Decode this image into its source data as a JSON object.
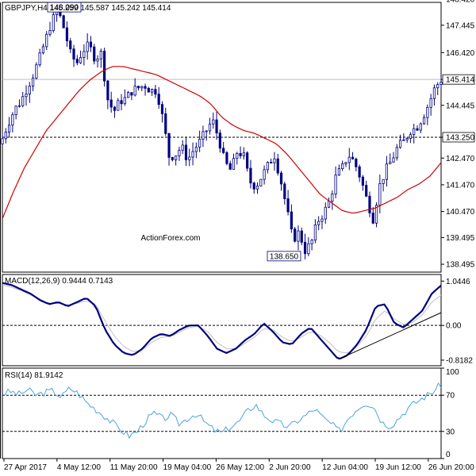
{
  "chart_data": [
    {
      "type": "candlestick",
      "title": "GBPJPY,H4 145.259 145.587 145.242 145.414",
      "watermark": "ActionForex.com",
      "ylim": [
        138.2,
        148.3
      ],
      "yticks": [
        "148.420",
        "147.445",
        "146.420",
        "145.414",
        "144.445",
        "143.250",
        "142.470",
        "141.470",
        "140.470",
        "139.495",
        "138.495"
      ],
      "current_price": "145.414",
      "horizontal_lines": [
        {
          "label": "143.250",
          "value": 143.25,
          "style": "dashed"
        },
        {
          "label": "145.414",
          "value": 145.414,
          "style": "solid"
        }
      ],
      "annotations": [
        {
          "label": "148.090",
          "value": 148.09,
          "at": "high"
        },
        {
          "label": "138.650",
          "value": 138.65,
          "at": "low"
        }
      ],
      "series": [
        {
          "type": "candles",
          "count": 130,
          "color": "#000080",
          "close_path": [
            143.2,
            143.8,
            144.3,
            144.6,
            145.1,
            145.6,
            146.2,
            146.9,
            147.6,
            148.0,
            147.3,
            146.4,
            146.0,
            146.5,
            146.7,
            146.2,
            146.4,
            144.7,
            144.2,
            144.6,
            144.7,
            145.0,
            145.1,
            145.2,
            145.0,
            145.0,
            143.9,
            142.5,
            142.6,
            142.9,
            142.4,
            142.8,
            143.1,
            143.5,
            143.9,
            143.2,
            142.3,
            142.0,
            142.7,
            142.6,
            141.6,
            141.4,
            141.8,
            142.2,
            142.6,
            141.7,
            140.6,
            139.4,
            139.7,
            139.0,
            139.3,
            140.1,
            140.4,
            140.9,
            141.8,
            142.1,
            142.6,
            142.3,
            141.7,
            140.9,
            140.2,
            141.4,
            142.0,
            142.4,
            142.9,
            143.1,
            143.5,
            143.6,
            144.0,
            144.5,
            145.1,
            145.4
          ]
        },
        {
          "type": "line",
          "name": "MA",
          "color": "#d00000",
          "values": [
            140.2,
            141.2,
            142.1,
            142.8,
            143.5,
            144.0,
            144.5,
            145.0,
            145.4,
            145.7,
            145.9,
            145.9,
            145.8,
            145.7,
            145.6,
            145.4,
            145.2,
            145.0,
            144.8,
            144.5,
            144.0,
            143.7,
            143.5,
            143.4,
            143.2,
            143.0,
            142.6,
            142.1,
            141.6,
            141.1,
            140.8,
            140.5,
            140.4,
            140.5,
            140.6,
            140.8,
            141.0,
            141.3,
            141.5,
            141.8,
            142.3
          ]
        }
      ]
    },
    {
      "type": "line",
      "title": "MACD(12,26,9) 0.9444 0.7143",
      "ylim": [
        -0.95,
        1.2
      ],
      "yticks": [
        "1.0446",
        "0.00",
        "-0.8182"
      ],
      "series": [
        {
          "name": "",
          "color": "#000080",
          "values": [
            1.0,
            0.95,
            0.85,
            0.75,
            0.6,
            0.5,
            0.55,
            0.45,
            0.55,
            0.65,
            0.45,
            -0.1,
            -0.45,
            -0.65,
            -0.7,
            -0.55,
            -0.3,
            -0.2,
            -0.25,
            -0.1,
            0.0,
            0.0,
            -0.25,
            -0.55,
            -0.65,
            -0.55,
            -0.35,
            -0.2,
            0.05,
            -0.15,
            -0.4,
            -0.45,
            -0.2,
            -0.05,
            -0.3,
            -0.55,
            -0.8,
            -0.7,
            -0.45,
            -0.1,
            0.45,
            0.5,
            0.05,
            -0.05,
            0.15,
            0.35,
            0.75,
            0.94
          ]
        },
        {
          "name": "",
          "color": "#c0c0c0",
          "values": [
            0.95,
            0.9,
            0.82,
            0.72,
            0.62,
            0.52,
            0.52,
            0.48,
            0.52,
            0.58,
            0.5,
            0.1,
            -0.25,
            -0.5,
            -0.62,
            -0.58,
            -0.4,
            -0.28,
            -0.26,
            -0.16,
            -0.05,
            -0.02,
            -0.15,
            -0.4,
            -0.55,
            -0.55,
            -0.42,
            -0.28,
            -0.08,
            -0.1,
            -0.28,
            -0.38,
            -0.28,
            -0.15,
            -0.22,
            -0.4,
            -0.62,
            -0.65,
            -0.5,
            -0.25,
            0.15,
            0.35,
            0.15,
            0.02,
            0.08,
            0.25,
            0.55,
            0.71
          ]
        }
      ],
      "trendline": {
        "from": {
          "index": 36,
          "value": -0.8
        },
        "to": {
          "index": 47,
          "value": 0.3
        }
      }
    },
    {
      "type": "line",
      "title": "RSI(14) 81.9142",
      "ylim": [
        0,
        100
      ],
      "yticks": [
        "100",
        "70",
        "30",
        "0"
      ],
      "levels": [
        70,
        30
      ],
      "series": [
        {
          "name": "",
          "color": "#4aa3df",
          "values": [
            72,
            74,
            71,
            76,
            70,
            73,
            75,
            68,
            78,
            72,
            62,
            55,
            48,
            40,
            32,
            25,
            30,
            42,
            50,
            44,
            48,
            38,
            45,
            50,
            40,
            32,
            28,
            35,
            40,
            52,
            60,
            48,
            42,
            38,
            35,
            42,
            48,
            55,
            45,
            38,
            30,
            45,
            55,
            62,
            58,
            40,
            36,
            45,
            55,
            62,
            68,
            74,
            82
          ]
        }
      ]
    }
  ],
  "x_axis": {
    "labels": [
      "27 Apr 2017",
      "4 May 12:00",
      "11 May 20:00",
      "19 May 04:00",
      "26 May 12:00",
      "2 Jun 20:00",
      "12 Jun 04:00",
      "19 Jun 12:00",
      "26 Jun 20:00"
    ]
  },
  "colors": {
    "candle": "#000080",
    "ma": "#d00000",
    "macd": "#000080",
    "signal": "#c0c0c0",
    "rsi": "#4aa3df",
    "grid": "#000000",
    "watermark": "#c8c8c8"
  }
}
